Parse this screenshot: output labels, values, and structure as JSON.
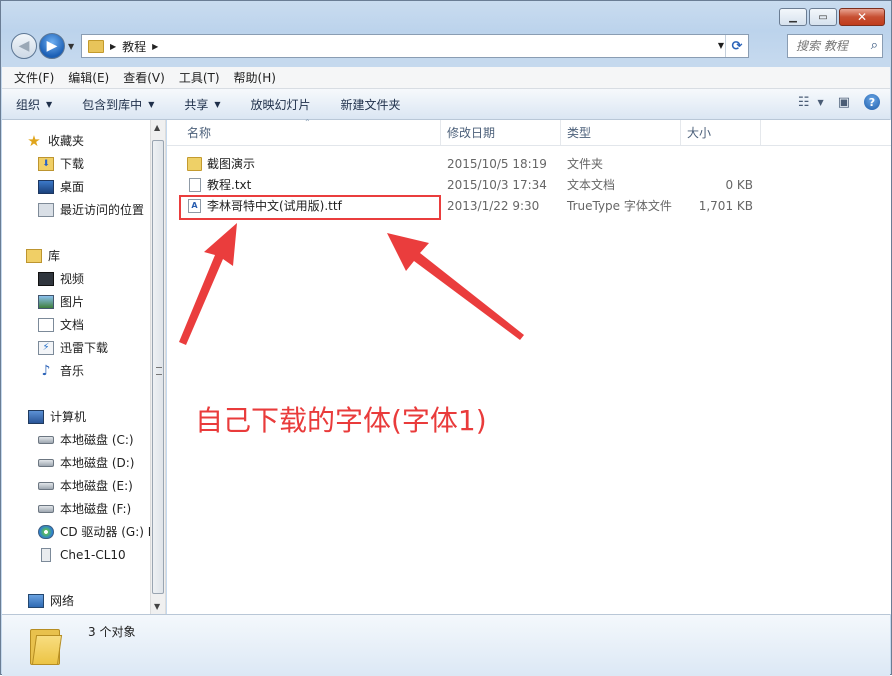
{
  "window": {
    "controls": [
      "minimize",
      "maximize",
      "close"
    ]
  },
  "address": {
    "crumbs": [
      "教程"
    ]
  },
  "search": {
    "placeholder": "搜索 教程"
  },
  "menu": [
    "文件(F)",
    "编辑(E)",
    "查看(V)",
    "工具(T)",
    "帮助(H)"
  ],
  "toolbar": {
    "organize": "组织",
    "include_library": "包含到库中",
    "share": "共享",
    "slideshow": "放映幻灯片",
    "new_folder": "新建文件夹"
  },
  "nav": {
    "favorites": "收藏夹",
    "downloads": "下载",
    "desktop": "桌面",
    "recent": "最近访问的位置",
    "libraries": "库",
    "videos": "视频",
    "pictures": "图片",
    "documents": "文档",
    "thunder": "迅雷下载",
    "music": "音乐",
    "computer": "计算机",
    "disk_c": "本地磁盘 (C:)",
    "disk_d": "本地磁盘 (D:)",
    "disk_e": "本地磁盘 (E:)",
    "disk_f": "本地磁盘 (F:)",
    "cd_drive": "CD 驱动器 (G:) H",
    "device": "Che1-CL10",
    "network": "网络"
  },
  "columns": {
    "name": "名称",
    "date": "修改日期",
    "type": "类型",
    "size": "大小"
  },
  "files": [
    {
      "name": "截图演示",
      "date": "2015/10/5 18:19",
      "type": "文件夹",
      "size": "",
      "icon": "folder-icon"
    },
    {
      "name": "教程.txt",
      "date": "2015/10/3 17:34",
      "type": "文本文档",
      "size": "0 KB",
      "icon": "text-file-icon"
    },
    {
      "name": "李林哥特中文(试用版).ttf",
      "date": "2013/1/22 9:30",
      "type": "TrueType 字体文件",
      "size": "1,701 KB",
      "icon": "font-file-icon"
    }
  ],
  "annotation": {
    "text": "自己下载的字体(字体1)",
    "color": "#ea3d3d"
  },
  "details": {
    "count": "3 个对象"
  }
}
